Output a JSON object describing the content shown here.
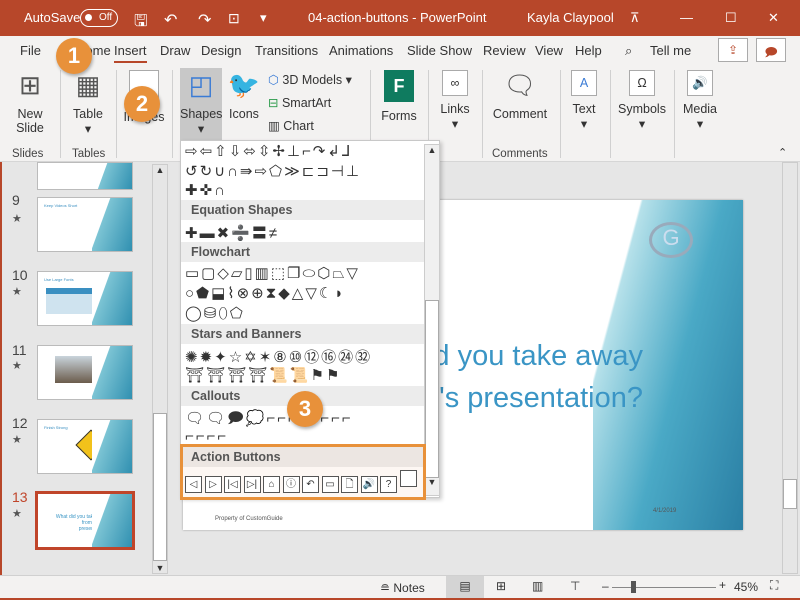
{
  "titlebar": {
    "autosave": "AutoSave",
    "autosave_state": "Off",
    "doc_title": "04-action-buttons - PowerPoint",
    "user": "Kayla Claypool"
  },
  "tabs": [
    "File",
    "Home",
    "Insert",
    "Draw",
    "Design",
    "Transitions",
    "Animations",
    "Slide Show",
    "Review",
    "View",
    "Help"
  ],
  "tell_me": "Tell me",
  "ribbon": {
    "new_slide": "New Slide",
    "table": "Table",
    "images": "Images",
    "shapes": "Shapes",
    "icons": "Icons",
    "models_3d": "3D Models",
    "smartart": "SmartArt",
    "chart": "Chart",
    "forms": "Forms",
    "links": "Links",
    "comment": "Comment",
    "text": "Text",
    "symbols": "Symbols",
    "media": "Media",
    "groups": {
      "slides": "Slides",
      "tables": "Tables",
      "comments": "Comments"
    }
  },
  "gallery": {
    "rows_top": [
      "⇨⇦⇧⇩⬄⇳✢⊥⌐↷↲⅃",
      "↺↻∪∩⇛⇨⬠≫⊏⊐⊣⊥",
      "✚✜∩"
    ],
    "sections": [
      {
        "title": "Equation Shapes",
        "rows": [
          "✚▬✖➗〓≠"
        ]
      },
      {
        "title": "Flowchart",
        "rows": [
          "▭▢◇▱▯▥⬚❐⬭⬡⏢▽",
          "○⬟⬓⌇⊗⊕⧗◆△▽☾◗",
          "◯⛁⬯⬠"
        ]
      },
      {
        "title": "Stars and Banners",
        "rows": [
          "✺✹✦☆✡✶⑧⑩⑫⑯㉔㉜",
          "⛩⛩⛩⛩📜📜⚑⚑"
        ]
      },
      {
        "title": "Callouts",
        "rows": [
          "🗨🗨🗩💭⌐⌐⌐⌐⌐⌐⌐⌐",
          "⌐⌐⌐⌐"
        ]
      },
      {
        "title": "Action Buttons"
      }
    ],
    "action_buttons": [
      "◁",
      "▷",
      "|◁",
      "▷|",
      "⌂",
      "ⓘ",
      "↶",
      "▭",
      "🗋",
      "🔊",
      "?",
      ""
    ]
  },
  "slides": [
    {
      "num": "9",
      "title": "Keep Videos Short"
    },
    {
      "num": "10",
      "title": "Use Large Fonts"
    },
    {
      "num": "11",
      "title": ""
    },
    {
      "num": "12",
      "title": "Finish Strong"
    },
    {
      "num": "13",
      "title": "What did you take away from today's presentation?"
    }
  ],
  "slide": {
    "line1": "What did you take away",
    "line2": "from today's presentation?",
    "footer": "Property of CustomGuide",
    "date": "4/1/2019"
  },
  "callouts": [
    "1",
    "2",
    "3"
  ],
  "status": {
    "notes": "Notes",
    "zoom": "45%",
    "zoom_percent": 45
  },
  "colors": {
    "accent": "#b7472a",
    "callout": "#e8913a",
    "slide_text": "#3a95c5"
  }
}
